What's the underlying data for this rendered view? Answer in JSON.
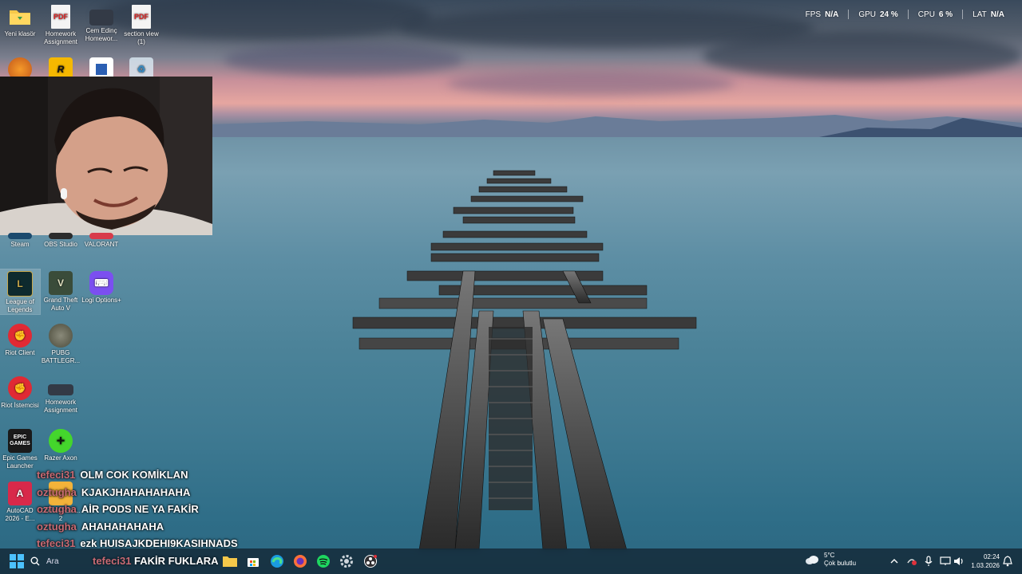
{
  "hud": {
    "fps_label": "FPS",
    "fps_value": "N/A",
    "gpu_label": "GPU",
    "gpu_value": "24 %",
    "cpu_label": "CPU",
    "cpu_value": "6 %",
    "lat_label": "LAT",
    "lat_value": "N/A"
  },
  "desktop_icons": {
    "yeni_klasor": "Yeni klasör",
    "homework1": "Homework Assignment",
    "cem": "Cem Edinç Homewor...",
    "section_view": "section view (1)",
    "steam": "Steam",
    "obs": "OBS Studio",
    "valorant": "VALORANT",
    "lol": "League of Legends",
    "gta": "Grand Theft Auto V",
    "logi": "Logi Options+",
    "riot_client": "Riot Client",
    "pubg": "PUBG BATTLEGR...",
    "riot_istemcisi": "Riot İstemcisi",
    "homework2": "Homework Assignment",
    "epic": "Epic Games Launcher",
    "razer": "Razer Axon",
    "autocad": "AutoCAD 2026 - E...",
    "counter_strike": "Counter-Stri... 2",
    "pdf_label": "PDF",
    "epic_glyph": "EPIC GAMES"
  },
  "chat": [
    {
      "user": "tefeci31",
      "message": "OLM COK KOMİKLAN"
    },
    {
      "user": "oztugha",
      "message": "KJAKJHAHAHAHAHA"
    },
    {
      "user": "oztugha",
      "message": "AİR PODS NE YA FAKİR"
    },
    {
      "user": "oztugha",
      "message": "AHAHAHAHAHA"
    },
    {
      "user": "tefeci31",
      "message": "ezk HUISAJKDEHI9KASIHNADS"
    },
    {
      "user": "tefeci31",
      "message": "FAKİR FUKLARA"
    }
  ],
  "taskbar": {
    "search_placeholder": "Ara",
    "weather_temp": "5°C",
    "weather_desc": "Çok bulutlu",
    "time": "02:24",
    "date": "1.03.2026"
  },
  "colors": {
    "chat_user": "#c86a73",
    "taskbar_bg": "#14283a"
  }
}
